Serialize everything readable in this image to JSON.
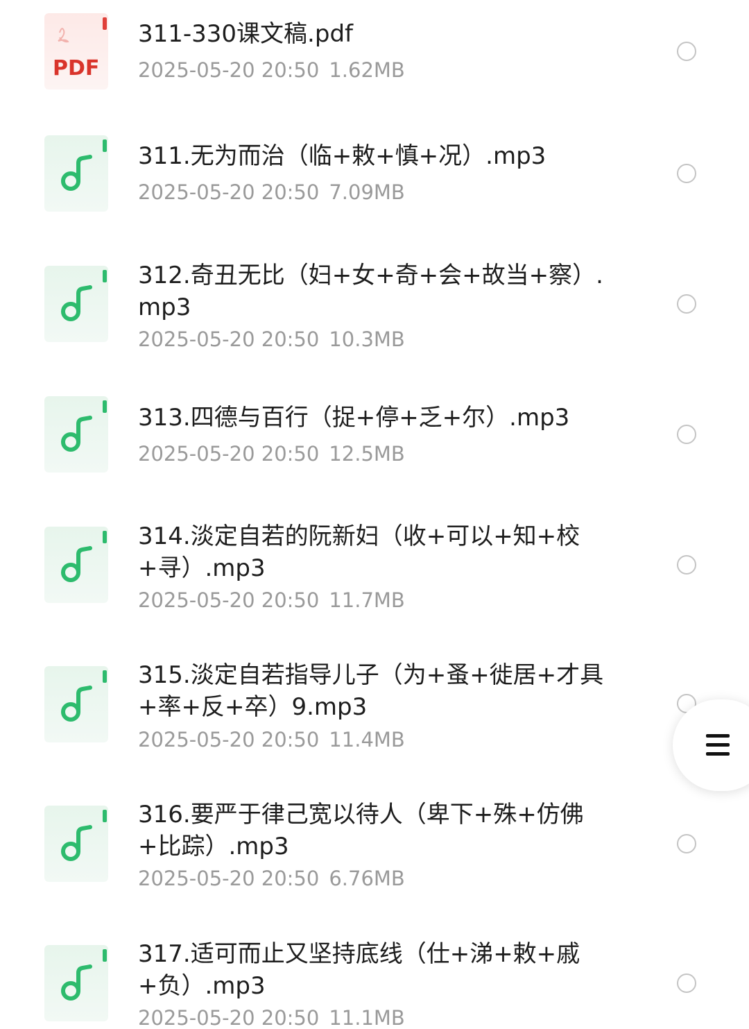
{
  "files": [
    {
      "name": "311-330课文稿.pdf",
      "date": "2025-05-20 20:50",
      "size": "1.62MB",
      "icon": "pdf-file-icon",
      "badge": "PDF"
    },
    {
      "name": "311.无为而治（临+敕+慎+况）.mp3",
      "date": "2025-05-20 20:50",
      "size": "7.09MB",
      "icon": "audio-file-icon"
    },
    {
      "name": "312.奇丑无比（妇+女+奇+会+故当+察）.mp3",
      "date": "2025-05-20 20:50",
      "size": "10.3MB",
      "icon": "audio-file-icon"
    },
    {
      "name": "313.四德与百行（捉+停+乏+尔）.mp3",
      "date": "2025-05-20 20:50",
      "size": "12.5MB",
      "icon": "audio-file-icon"
    },
    {
      "name": "314.淡定自若的阮新妇（收+可以+知+校+寻）.mp3",
      "date": "2025-05-20 20:50",
      "size": "11.7MB",
      "icon": "audio-file-icon"
    },
    {
      "name": "315.淡定自若指导儿子（为+蚤+徙居+才具+率+反+卒）9.mp3",
      "date": "2025-05-20 20:50",
      "size": "11.4MB",
      "icon": "audio-file-icon"
    },
    {
      "name": "316.要严于律己宽以待人（卑下+殊+仿佛+比踪）.mp3",
      "date": "2025-05-20 20:50",
      "size": "6.76MB",
      "icon": "audio-file-icon"
    },
    {
      "name": "317.适可而止又坚持底线（仕+涕+敕+戚+负）.mp3",
      "date": "2025-05-20 20:50",
      "size": "11.1MB",
      "icon": "audio-file-icon"
    }
  ],
  "floating_menu": {
    "icon": "menu-icon"
  },
  "colors": {
    "pdf_red": "#d9342b",
    "audio_green": "#2dbb6d",
    "icon_bg": "#eef7f1",
    "text_primary": "#1d1d1d",
    "text_secondary": "#9a9a9a"
  }
}
